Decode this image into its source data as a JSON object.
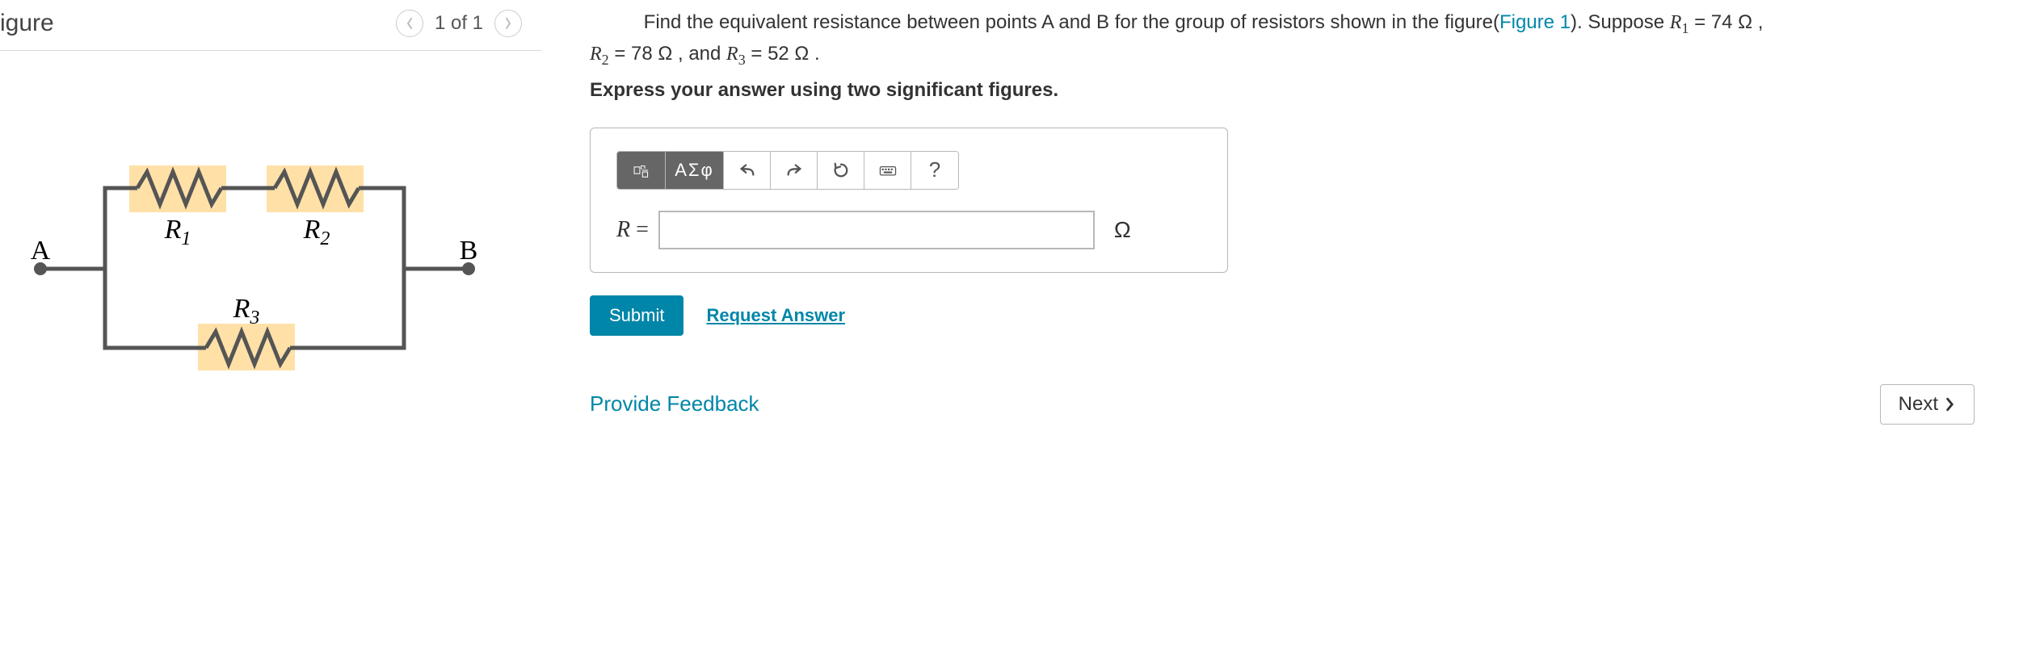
{
  "figure": {
    "title": "igure",
    "pager": "1 of 1",
    "labels": {
      "A": "A",
      "B": "B",
      "R1": "R",
      "R1sub": "1",
      "R2": "R",
      "R2sub": "2",
      "R3": "R",
      "R3sub": "3"
    }
  },
  "question": {
    "prefix": "Find the equivalent resistance between points A and B for the group of resistors shown in the figure(",
    "figlink": "Figure 1",
    "afterfig": "). Suppose ",
    "r1_sym": "R",
    "r1_sub": "1",
    "r1_val": " = 74 Ω , ",
    "r2_sym": "R",
    "r2_sub": "2",
    "r2_val": " = 78 Ω , and ",
    "r3_sym": "R",
    "r3_sub": "3",
    "r3_val": " = 52 Ω .",
    "instruction": "Express your answer using two significant figures."
  },
  "toolbar": {
    "greek": "ΑΣφ",
    "help": "?"
  },
  "input": {
    "label_sym": "R",
    "label_eq": " = ",
    "unit": "Ω",
    "value": ""
  },
  "actions": {
    "submit": "Submit",
    "request": "Request Answer",
    "feedback": "Provide Feedback",
    "next": "Next"
  }
}
